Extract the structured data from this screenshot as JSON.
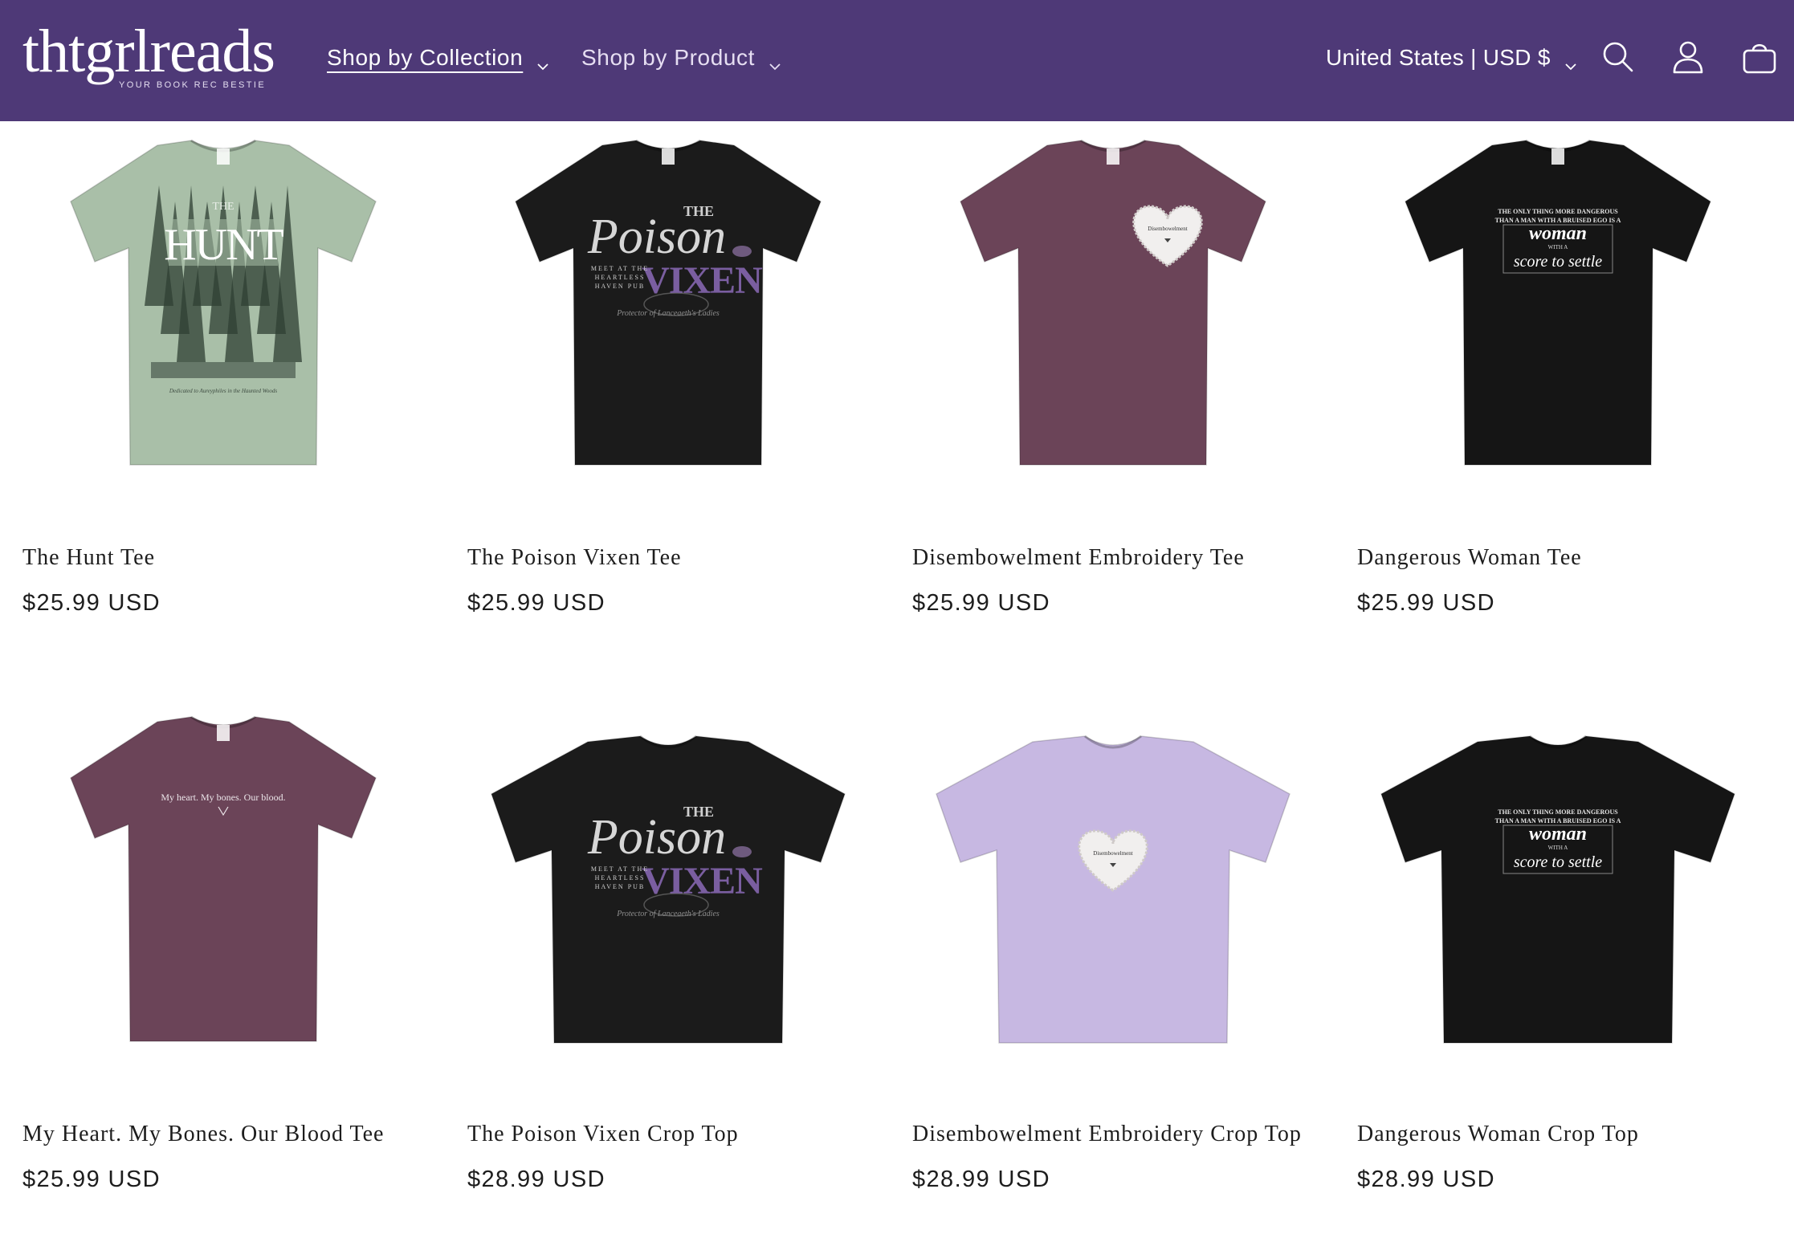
{
  "header": {
    "logo_text": "thtgrlreads",
    "logo_tagline": "YOUR BOOK REC BESTIE",
    "nav": [
      {
        "label": "Shop by Collection",
        "active": true
      },
      {
        "label": "Shop by Product",
        "active": false
      }
    ],
    "country_selector": "United States | USD $",
    "icons": [
      "search-icon",
      "account-icon",
      "cart-icon"
    ],
    "background_color": "#4e3977"
  },
  "products": [
    {
      "title": "The Hunt Tee",
      "price": "$25.99 USD",
      "garment": "tee",
      "shirt_color": "#a9bfa8",
      "print": {
        "main": "HUNT",
        "top": "THE",
        "script": "Dedicated to Aureyphiles in the Haunted Woods"
      }
    },
    {
      "title": "The Poison Vixen Tee",
      "price": "$25.99 USD",
      "garment": "tee",
      "shirt_color": "#1b1b1b",
      "print": {
        "top": "THE",
        "script_word": "Poison",
        "main": "VIXEN",
        "left_lines": [
          "MEET AT THE",
          "HEARTLESS",
          "HAVEN PUB"
        ],
        "script": "Protector of Lanceaeth's Ladies"
      }
    },
    {
      "title": "Disembowelment Embroidery Tee",
      "price": "$25.99 USD",
      "garment": "tee",
      "shirt_color": "#6b4458",
      "print": {
        "heart_text": "Disembowelment"
      }
    },
    {
      "title": "Dangerous Woman Tee",
      "price": "$25.99 USD",
      "garment": "tee",
      "shirt_color": "#151515",
      "print": {
        "top_lines": [
          "THE ONLY THING MORE DANGEROUS",
          "THAN A MAN WITH A BRUISED EGO IS A"
        ],
        "main": "woman",
        "small": "WITH A",
        "script": "score to settle"
      }
    },
    {
      "title": "My Heart. My Bones. Our Blood Tee",
      "price": "$25.99 USD",
      "garment": "tee",
      "shirt_color": "#6b4458",
      "print": {
        "line": "My heart. My bones. Our blood."
      }
    },
    {
      "title": "The Poison Vixen Crop Top",
      "price": "$28.99 USD",
      "garment": "crop",
      "shirt_color": "#1b1b1b",
      "print": {
        "top": "THE",
        "script_word": "Poison",
        "main": "VIXEN",
        "left_lines": [
          "MEET AT THE",
          "HEARTLESS",
          "HAVEN PUB"
        ],
        "script": "Protector of Lanceaeth's Ladies"
      }
    },
    {
      "title": "Disembowelment Embroidery Crop Top",
      "price": "$28.99 USD",
      "garment": "crop",
      "shirt_color": "#c7b8e2",
      "print": {
        "heart_text": "Disembowelment"
      }
    },
    {
      "title": "Dangerous Woman Crop Top",
      "price": "$28.99 USD",
      "garment": "crop",
      "shirt_color": "#151515",
      "print": {
        "top_lines": [
          "THE ONLY THING MORE DANGEROUS",
          "THAN A MAN WITH A BRUISED EGO IS A"
        ],
        "main": "woman",
        "small": "WITH A",
        "script": "score to settle"
      }
    }
  ]
}
